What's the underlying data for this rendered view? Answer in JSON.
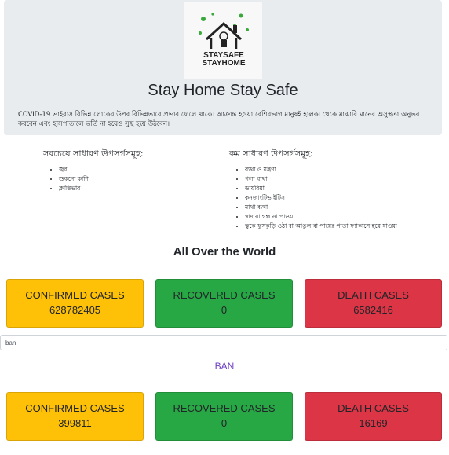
{
  "hero": {
    "logo_line1": "STAYSAFE",
    "logo_line2": "STAYHOME",
    "title": "Stay Home Stay Safe",
    "text": "COVID-19 ভাইরাস বিভিন্ন লোকের উপর বিভিন্নভাবে প্রভাব ফেলে থাকে। আক্রান্ত হওয়া বেশিরভাগ মানুষই হালকা থেকে মাঝারি মানের অসুস্থতা অনুভব করবেন এবং হাসপাতালে ভর্তি না হয়েও সুস্থ হয়ে উঠবেন।"
  },
  "symptoms": {
    "common": {
      "heading": "সবচেয়ে সাধারণ উপসর্গসমূহ:",
      "items": [
        "জ্বর",
        "শুকনো কাশি",
        "ক্লান্তিভাব"
      ]
    },
    "less_common": {
      "heading": "কম সাধারণ উপসর্গসমূহ:",
      "items": [
        "ব্যথা ও যন্ত্রণা",
        "গলা ব্যথা",
        "ডায়রিয়া",
        "কনজাংটিভাইটিস",
        "মাথা ব্যথা",
        "স্বাদ বা গন্ধ না পাওয়া",
        "ত্বকে ফুসকুড়ি ওঠা বা আঙুল বা পায়ের পাতা ফ্যাকাসে হয়ে যাওয়া"
      ]
    }
  },
  "world": {
    "title": "All Over the World",
    "confirmed_label": "CONFIRMED CASES",
    "confirmed_value": "628782405",
    "recovered_label": "RECOVERED CASES",
    "recovered_value": "0",
    "death_label": "DEATH CASES",
    "death_value": "6582416"
  },
  "search": {
    "value": "ban"
  },
  "country": {
    "title": "BAN",
    "confirmed_label": "CONFIRMED CASES",
    "confirmed_value": "399811",
    "recovered_label": "RECOVERED CASES",
    "recovered_value": "0",
    "death_label": "DEATH CASES",
    "death_value": "16169"
  },
  "colors": {
    "confirmed": "#ffc107",
    "recovered": "#28a745",
    "death": "#dc3545",
    "country_title": "#6f42c1"
  }
}
